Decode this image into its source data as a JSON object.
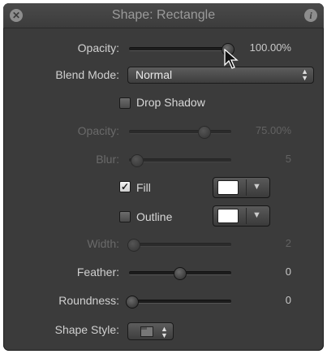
{
  "window": {
    "title": "Shape: Rectangle"
  },
  "icons": {
    "close": "close-circle-icon",
    "info": "info-icon"
  },
  "rows": {
    "opacity": {
      "label": "Opacity:",
      "value": "100.00%",
      "level": 1.0
    },
    "blend_mode": {
      "label": "Blend Mode:",
      "selected": "Normal"
    },
    "drop_shadow": {
      "label": "Drop Shadow",
      "checked": false
    },
    "shadow_opacity": {
      "label": "Opacity:",
      "value": "75.00%",
      "level": 0.75,
      "enabled": false
    },
    "blur": {
      "label": "Blur:",
      "value": "5",
      "level": 0.05,
      "enabled": false
    },
    "fill": {
      "label": "Fill",
      "checked": true,
      "color": "#ffffff"
    },
    "outline": {
      "label": "Outline",
      "checked": false,
      "color": "#ffffff"
    },
    "width": {
      "label": "Width:",
      "value": "2",
      "level": 0.02,
      "enabled": false
    },
    "feather": {
      "label": "Feather:",
      "value": "0",
      "level": 0.5
    },
    "roundness": {
      "label": "Roundness:",
      "value": "0",
      "level": 0.0
    },
    "shape_style": {
      "label": "Shape Style:"
    }
  },
  "colors": {
    "panel": "#3b3b3b",
    "text": "#d0d0d0",
    "disabled_text": "#6a6a6a"
  },
  "check_glyph": "✓"
}
